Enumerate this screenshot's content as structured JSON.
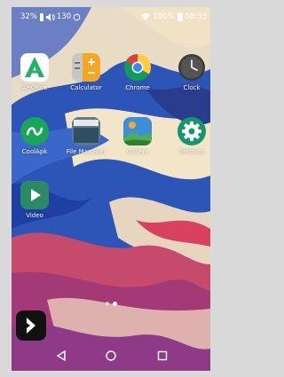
{
  "status_bar": {
    "battery_left": "32%",
    "net_speed": "130",
    "battery_right": "100%",
    "time": "08:33"
  },
  "apps": [
    {
      "label": "APKPure",
      "icon": "apkpure-icon"
    },
    {
      "label": "Calculator",
      "icon": "calculator-icon"
    },
    {
      "label": "Chrome",
      "icon": "chrome-icon"
    },
    {
      "label": "Clock",
      "icon": "clock-icon"
    },
    {
      "label": "CoolApk",
      "icon": "coolapk-icon"
    },
    {
      "label": "File Manager",
      "icon": "file-manager-icon"
    },
    {
      "label": "Gallery",
      "icon": "gallery-icon"
    },
    {
      "label": "Settings",
      "icon": "gear-icon"
    },
    {
      "label": "Video",
      "icon": "play-icon"
    }
  ],
  "page_indicator": {
    "count": 2,
    "active_index": 1
  },
  "colors": {
    "apkpure": "#24b26b",
    "calculator": "#f5a623",
    "coolapk": "#17a65a",
    "settings": "#14986b",
    "video": "#2b8a66",
    "wallpaper_blue": "#2d54b7"
  }
}
